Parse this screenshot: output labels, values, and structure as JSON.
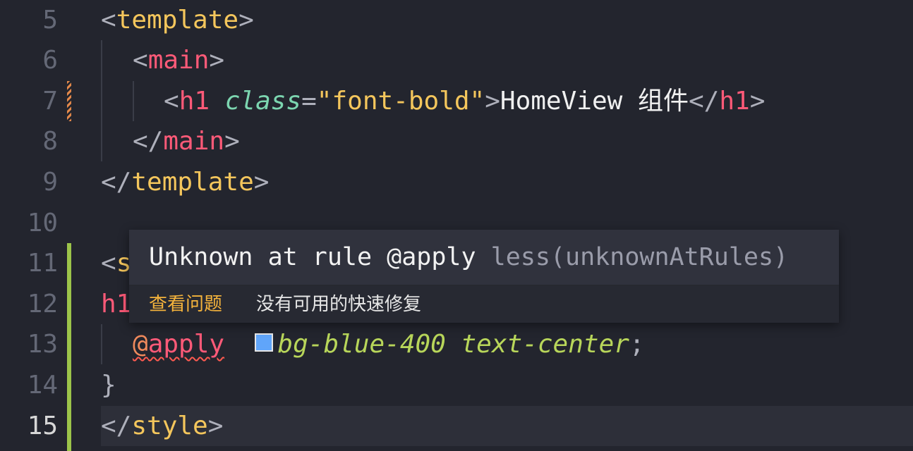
{
  "editor": {
    "lines": [
      {
        "num": "5",
        "tokens": [
          "<",
          "template",
          ">"
        ]
      },
      {
        "num": "6",
        "tokens": [
          "<",
          "main",
          ">"
        ]
      },
      {
        "num": "7",
        "tokens": [
          "<",
          "h1",
          " ",
          "class",
          "=",
          "\"font-bold\"",
          ">",
          "HomeView 组件",
          "</",
          "h1",
          ">"
        ]
      },
      {
        "num": "8",
        "tokens": [
          "</",
          "main",
          ">"
        ]
      },
      {
        "num": "9",
        "tokens": [
          "</",
          "template",
          ">"
        ]
      },
      {
        "num": "10",
        "tokens": []
      },
      {
        "num": "11",
        "tokens": [
          "<",
          "s"
        ]
      },
      {
        "num": "12",
        "tokens": [
          "h1"
        ]
      },
      {
        "num": "13",
        "tokens": [
          "@",
          "apply",
          "bg-blue-400 text-center",
          ";"
        ]
      },
      {
        "num": "14",
        "tokens": [
          "}"
        ]
      },
      {
        "num": "15",
        "tokens": [
          "</",
          "style",
          ">"
        ]
      }
    ],
    "current_line": "15",
    "swatch_color": "#60a5fa"
  },
  "hover": {
    "message": "Unknown at rule @apply",
    "source": "less(unknownAtRules)",
    "action_label": "查看问题",
    "no_fix_label": "没有可用的快速修复"
  }
}
